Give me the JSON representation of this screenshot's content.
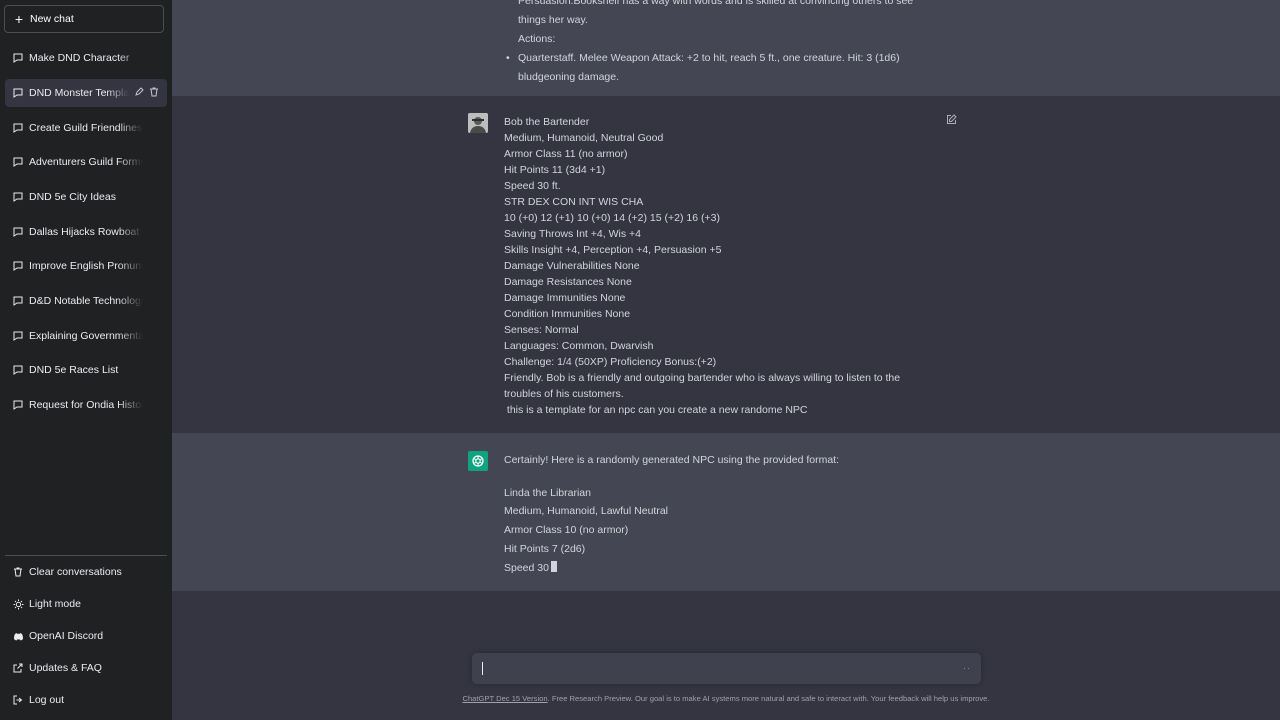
{
  "sidebar": {
    "new_chat": "New chat",
    "conversations": [
      "Make DND Character",
      "DND Monster Template",
      "Create Guild Friendliness Scale",
      "Adventurers Guild Formed",
      "DND 5e City Ideas",
      "Dallas Hijacks Rowboat",
      "Improve English Pronunciation",
      "D&D Notable Technologies",
      "Explaining Governmental Empire",
      "DND 5e Races List",
      "Request for Ondia History details"
    ],
    "bottom": {
      "clear": "Clear conversations",
      "light": "Light mode",
      "discord": "OpenAI Discord",
      "updates": "Updates & FAQ",
      "logout": "Log out"
    }
  },
  "prev_message": {
    "line1": "Persuasion.Bookshelf has a way with words and is skilled at convincing others to see",
    "line2": "things her way.",
    "line3": "Actions:",
    "line4": "Quarterstaff. Melee Weapon Attack: +2 to hit, reach 5 ft., one creature. Hit: 3 (1d6)",
    "line5": "bludgeoning damage."
  },
  "user_message": [
    "Bob the Bartender",
    "Medium, Humanoid, Neutral Good",
    "Armor Class 11 (no armor)",
    "Hit Points 11 (3d4 +1)",
    "Speed 30 ft.",
    "STR DEX CON INT WIS CHA",
    "10 (+0) 12 (+1) 10 (+0) 14 (+2) 15 (+2) 16 (+3)",
    "Saving Throws Int +4, Wis +4",
    "Skills Insight +4, Perception +4, Persuasion +5",
    "Damage Vulnerabilities None",
    "Damage Resistances None",
    "Damage Immunities None",
    "Condition Immunities None",
    "Senses: Normal",
    "Languages: Common, Dwarvish",
    "Challenge: 1/4 (50XP) Proficiency Bonus:(+2)",
    "Friendly. Bob is a friendly and outgoing bartender who is always willing to listen to the",
    "troubles of his customers.",
    " this is a template for an npc can you create a new randome NPC"
  ],
  "assistant_message": {
    "intro": "Certainly! Here is a randomly generated NPC using the provided format:",
    "lines": [
      "Linda the Librarian",
      "Medium, Humanoid, Lawful Neutral",
      "Armor Class 10 (no armor)",
      "Hit Points 7 (2d6)",
      "Speed 30"
    ]
  },
  "input": {
    "placeholder": ""
  },
  "footer": {
    "version": "ChatGPT Dec 15 Version",
    "text": ". Free Research Preview. Our goal is to make AI systems more natural and safe to interact with. Your feedback will help us improve."
  },
  "colors": {
    "sidebar_bg": "#202123",
    "main_bg": "#343541",
    "alt_bg": "#444654",
    "accent": "#10a37f"
  }
}
